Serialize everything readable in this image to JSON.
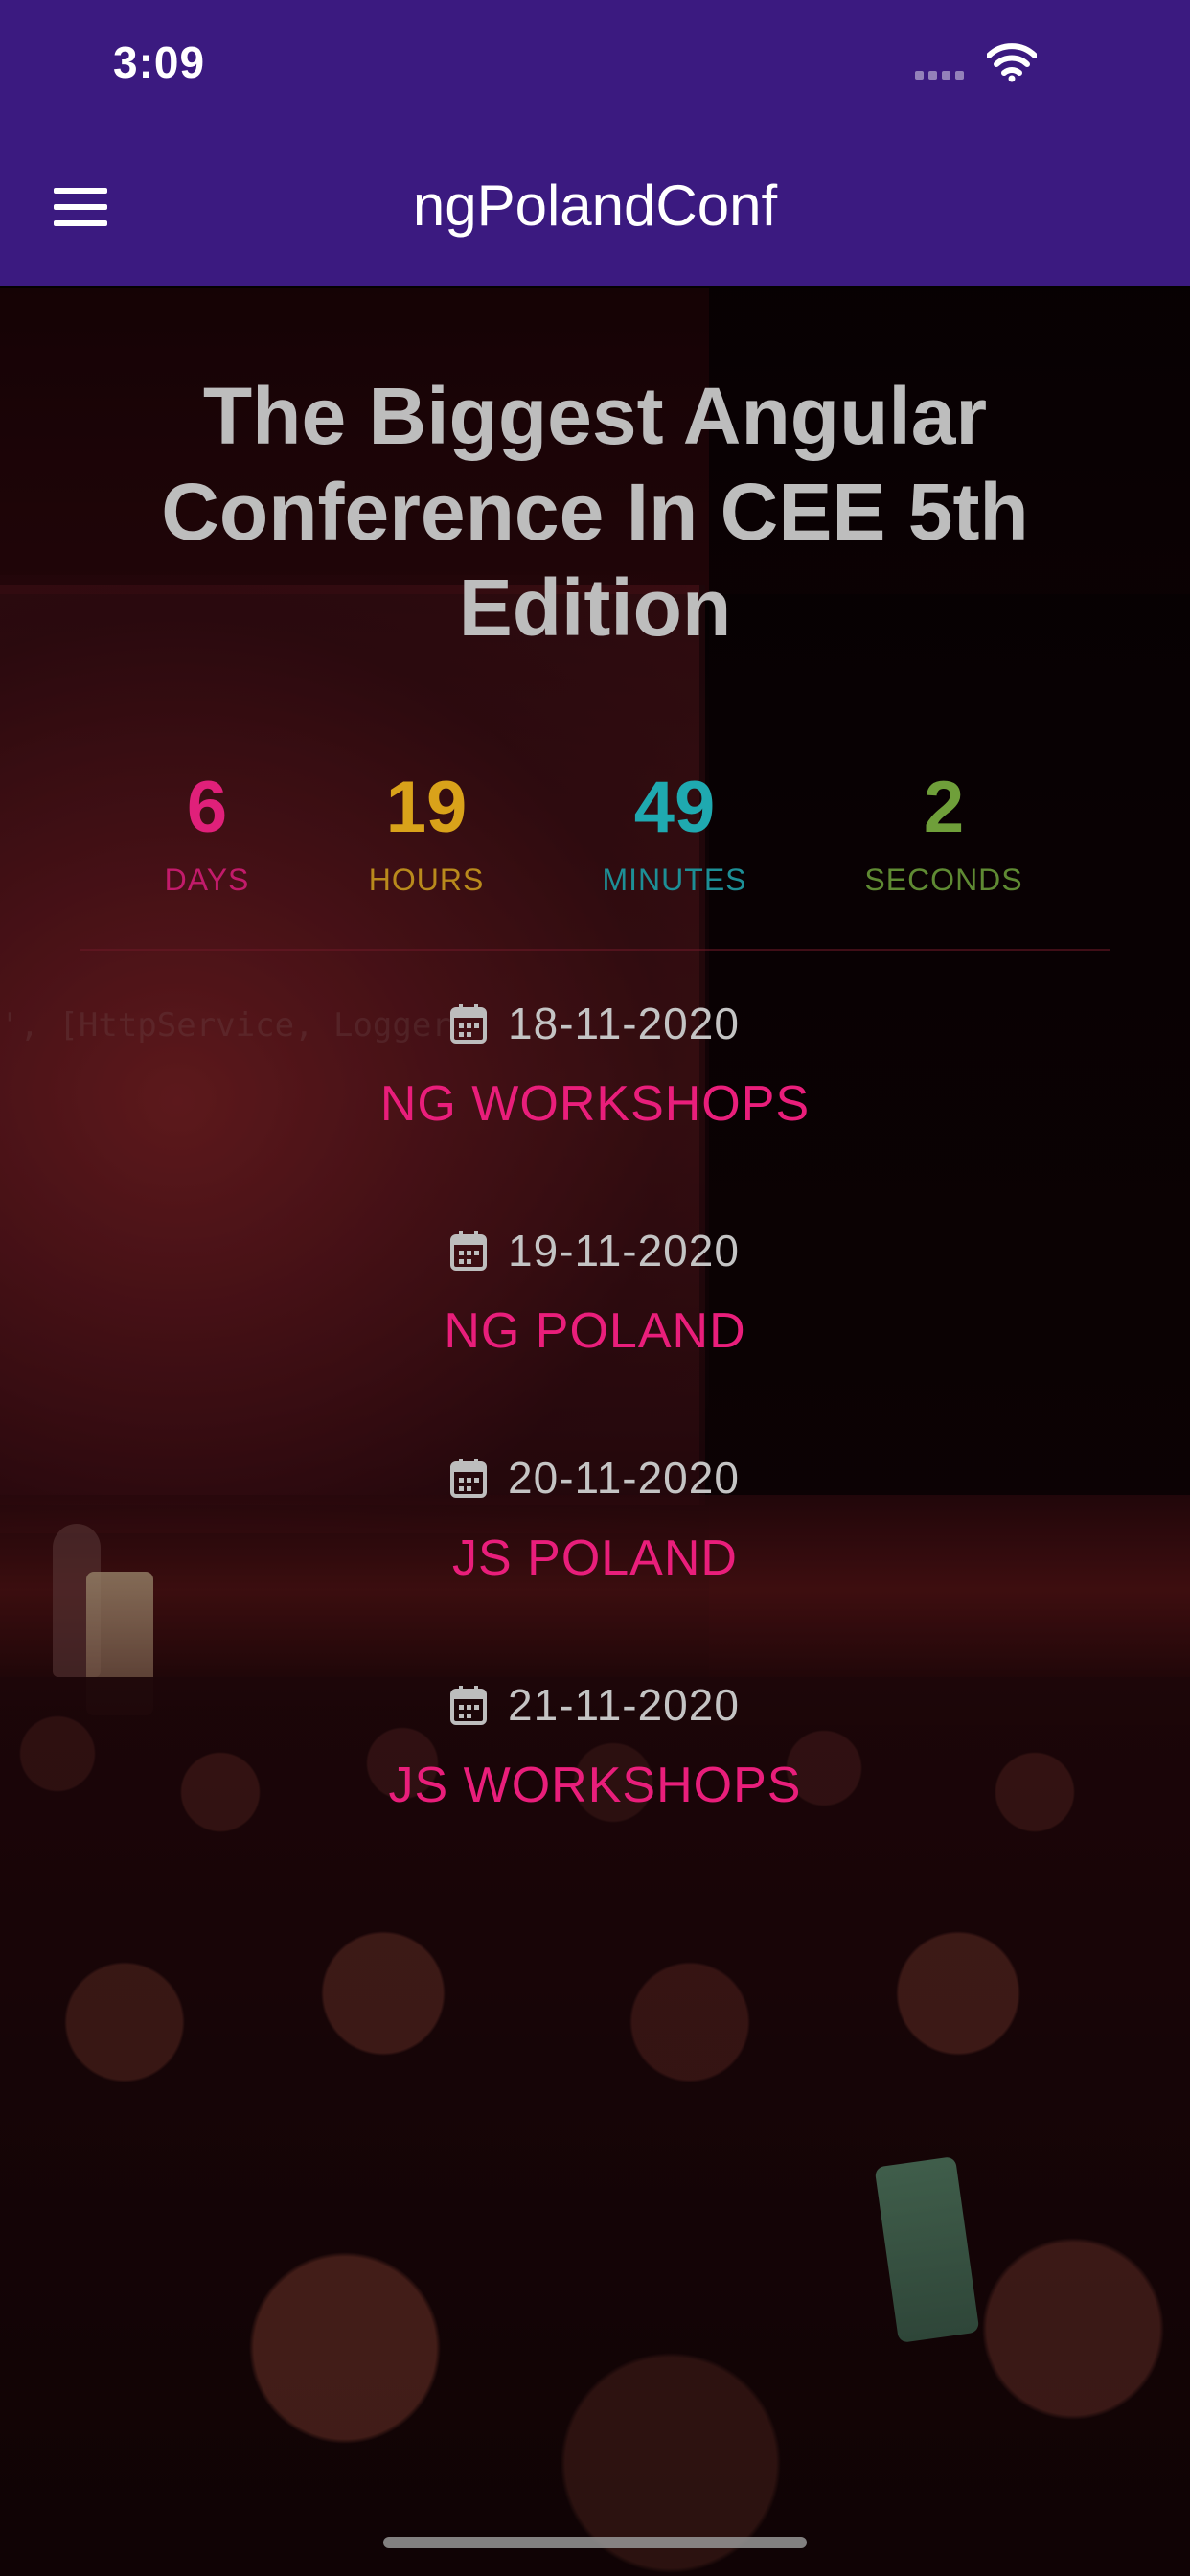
{
  "status_bar": {
    "time": "3:09"
  },
  "header": {
    "title": "ngPolandConf",
    "menu_icon": "menu-icon",
    "background_color": "#3b1a80"
  },
  "hero": {
    "headline": "The Biggest Angular Conference In CEE 5th Edition",
    "background_code_text": "', [HttpService, Logger"
  },
  "countdown": {
    "units": [
      {
        "value": "6",
        "label": "DAYS",
        "color": "#e0207a"
      },
      {
        "value": "19",
        "label": "HOURS",
        "color": "#d9a21a"
      },
      {
        "value": "49",
        "label": "MINUTES",
        "color": "#1fa9b0"
      },
      {
        "value": "2",
        "label": "SECONDS",
        "color": "#6f9f3a"
      }
    ]
  },
  "events": [
    {
      "date": "18-11-2020",
      "name": "NG WORKSHOPS",
      "icon": "calendar-icon"
    },
    {
      "date": "19-11-2020",
      "name": "NG POLAND",
      "icon": "calendar-icon"
    },
    {
      "date": "20-11-2020",
      "name": "JS POLAND",
      "icon": "calendar-icon"
    },
    {
      "date": "21-11-2020",
      "name": "JS WORKSHOPS",
      "icon": "calendar-icon"
    }
  ],
  "colors": {
    "accent_pink": "#e91e7b",
    "headline_gray": "#bdbdbd"
  }
}
